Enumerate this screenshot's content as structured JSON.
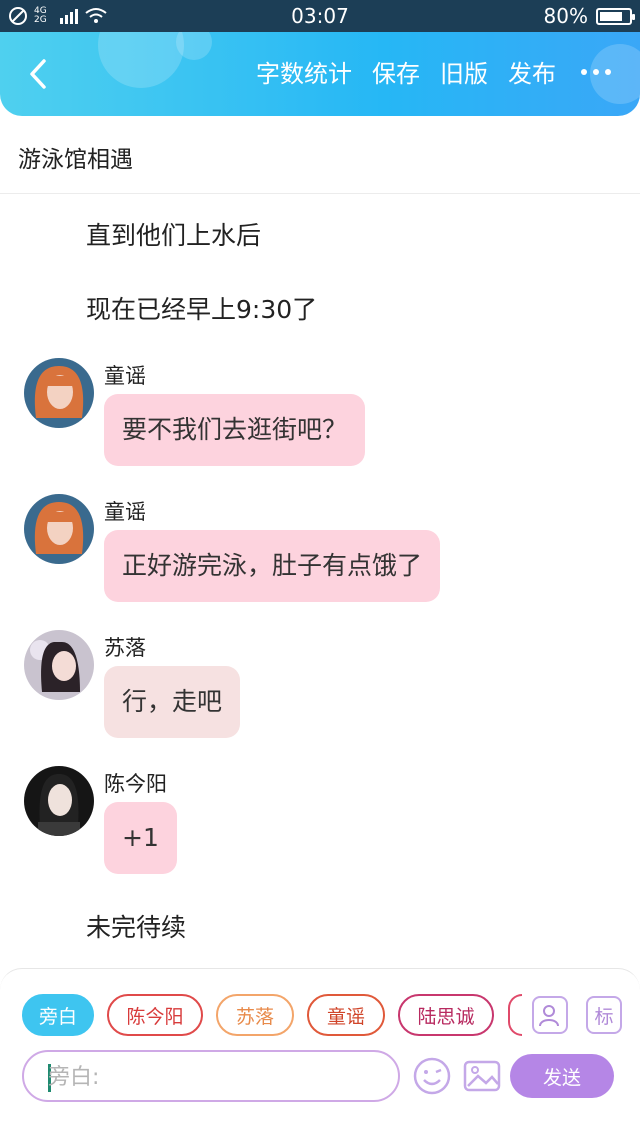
{
  "status_bar": {
    "network": "4G 2G",
    "time": "03:07",
    "battery_text": "80%",
    "battery_level": 0.8
  },
  "header": {
    "menu": [
      "字数统计",
      "保存",
      "旧版",
      "发布"
    ]
  },
  "story": {
    "title": "游泳馆相遇",
    "narration_top": [
      "直到他们上水后",
      "现在已经早上9:30了"
    ],
    "messages": [
      {
        "name": "童谣",
        "text": "要不我们去逛街吧？"
      },
      {
        "name": "童谣",
        "text": "正好游完泳，肚子有点饿了"
      },
      {
        "name": "苏落",
        "text": "行，走吧"
      },
      {
        "name": "陈今阳",
        "text": "+1"
      }
    ],
    "narration_bottom": "未完待续"
  },
  "composer": {
    "roles": [
      "旁白",
      "陈今阳",
      "苏落",
      "童谣",
      "陆思诚"
    ],
    "icon_label_tag": "标",
    "input_placeholder": "旁白:",
    "send_label": "发送"
  },
  "colors": {
    "header_start": "#4fd0ef",
    "header_end": "#3aa7f7",
    "bubble_pink": "#fdd3de",
    "bubble_beige": "#f6e1e1",
    "accent_purple": "#b586e6",
    "chip_narrator_bg": "#3ec5f0"
  }
}
